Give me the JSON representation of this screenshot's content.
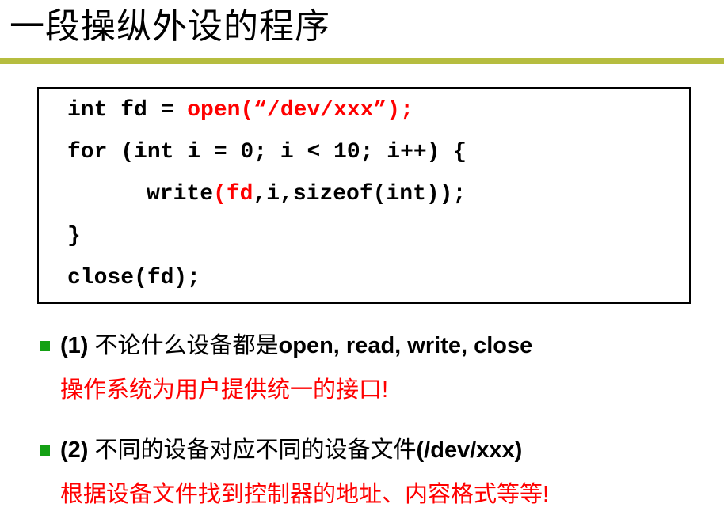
{
  "title": "一段操纵外设的程序",
  "colors": {
    "rule": "#b6bd3f",
    "highlight": "#ff0000",
    "bullet": "#14a014"
  },
  "code": {
    "line1": {
      "prefix": "int fd = ",
      "highlight": "open(“/dev/xxx”);"
    },
    "line2": "for (int i = 0; i < 10; i++) {",
    "line3": {
      "prefix": "write",
      "highlight": "(fd",
      "suffix": ",i,sizeof(int));"
    },
    "line4": "}",
    "line5": "close(fd);"
  },
  "points": [
    {
      "number": "(1)",
      "text_cn": " 不论什么设备都是",
      "text_en": "open, read, write, close",
      "sub": "操作系统为用户提供统一的接口!"
    },
    {
      "number": "(2)",
      "text_cn": " 不同的设备对应不同的设备文件",
      "text_en": "(/dev/xxx)",
      "sub": "根据设备文件找到控制器的地址、内容格式等等!"
    }
  ]
}
